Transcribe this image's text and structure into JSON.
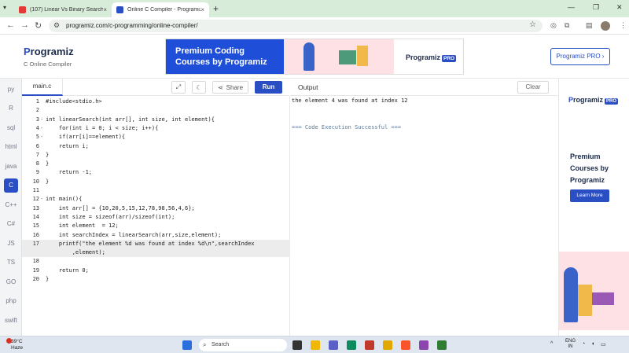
{
  "browser": {
    "tabs": [
      {
        "title": "(107) Linear Vs Binary Search -",
        "favicon_color": "#e53935"
      },
      {
        "title": "Online C Compiler - Programiz",
        "favicon_color": "#2a4fc4"
      }
    ],
    "url": "programiz.com/c-programming/online-compiler/",
    "new_tab": "+",
    "close_glyph": "×"
  },
  "header": {
    "logo": "rogramiz",
    "logo_initial": "P",
    "subtitle": "C Online Compiler",
    "banner_text": "Premium Coding Courses by Programiz",
    "banner_logo": "Programiz",
    "banner_pro": "PRO",
    "pro_button": "Programiz PRO ›"
  },
  "sidebar": {
    "items": [
      "py",
      "R",
      "sql",
      "html",
      "java",
      "C",
      "C++",
      "C#",
      "JS",
      "TS",
      "GO",
      "php",
      "swift"
    ],
    "selected_index": 5
  },
  "editor": {
    "filename": "main.c",
    "share_label": "Share",
    "run_label": "Run",
    "lines": [
      {
        "n": "1",
        "fold": "",
        "text": "#include<stdio.h>"
      },
      {
        "n": "2",
        "fold": "",
        "text": ""
      },
      {
        "n": "3",
        "fold": "-",
        "text": "int linearSearch(int arr[], int size, int element){"
      },
      {
        "n": "4",
        "fold": "-",
        "text": "    for(int i = 0; i < size; i++){"
      },
      {
        "n": "5",
        "fold": "-",
        "text": "    if(arr[i]==element){"
      },
      {
        "n": "6",
        "fold": "",
        "text": "    return i;"
      },
      {
        "n": "7",
        "fold": "",
        "text": "}"
      },
      {
        "n": "8",
        "fold": "",
        "text": "}"
      },
      {
        "n": "9",
        "fold": "",
        "text": "    return -1;"
      },
      {
        "n": "10",
        "fold": "",
        "text": "}"
      },
      {
        "n": "11",
        "fold": "",
        "text": ""
      },
      {
        "n": "12",
        "fold": "-",
        "text": "int main(){"
      },
      {
        "n": "13",
        "fold": "",
        "text": "    int arr[] = {10,20,5,15,12,78,98,56,4,6};"
      },
      {
        "n": "14",
        "fold": "",
        "text": "    int size = sizeof(arr)/sizeof(int);"
      },
      {
        "n": "15",
        "fold": "",
        "text": "    int element  = 12;"
      },
      {
        "n": "16",
        "fold": "",
        "text": "    int searchIndex = linearSearch(arr,size,element);"
      },
      {
        "n": "17",
        "fold": "",
        "text": "    printf(\"the element %d was found at index %d\\n\",searchIndex"
      },
      {
        "n": "",
        "fold": "",
        "text": "        ,element);"
      },
      {
        "n": "18",
        "fold": "",
        "text": ""
      },
      {
        "n": "19",
        "fold": "",
        "text": "    return 0;"
      },
      {
        "n": "20",
        "fold": "",
        "text": "}"
      }
    ],
    "highlighted_index": 16
  },
  "output": {
    "title": "Output",
    "clear_label": "Clear",
    "lines": [
      "the element 4 was found at index 12",
      "",
      "",
      "=== Code Execution Successful ==="
    ]
  },
  "ad": {
    "logo": "rogramiz",
    "logo_initial": "P",
    "pro": "PRO",
    "text": "Premium Courses by Programiz",
    "button": "Learn More"
  },
  "taskbar": {
    "weather_temp": "39°C",
    "weather_desc": "Haze",
    "weather_badge": "6",
    "search_label": "Search",
    "lang_top": "ENG",
    "lang_bottom": "IN"
  }
}
